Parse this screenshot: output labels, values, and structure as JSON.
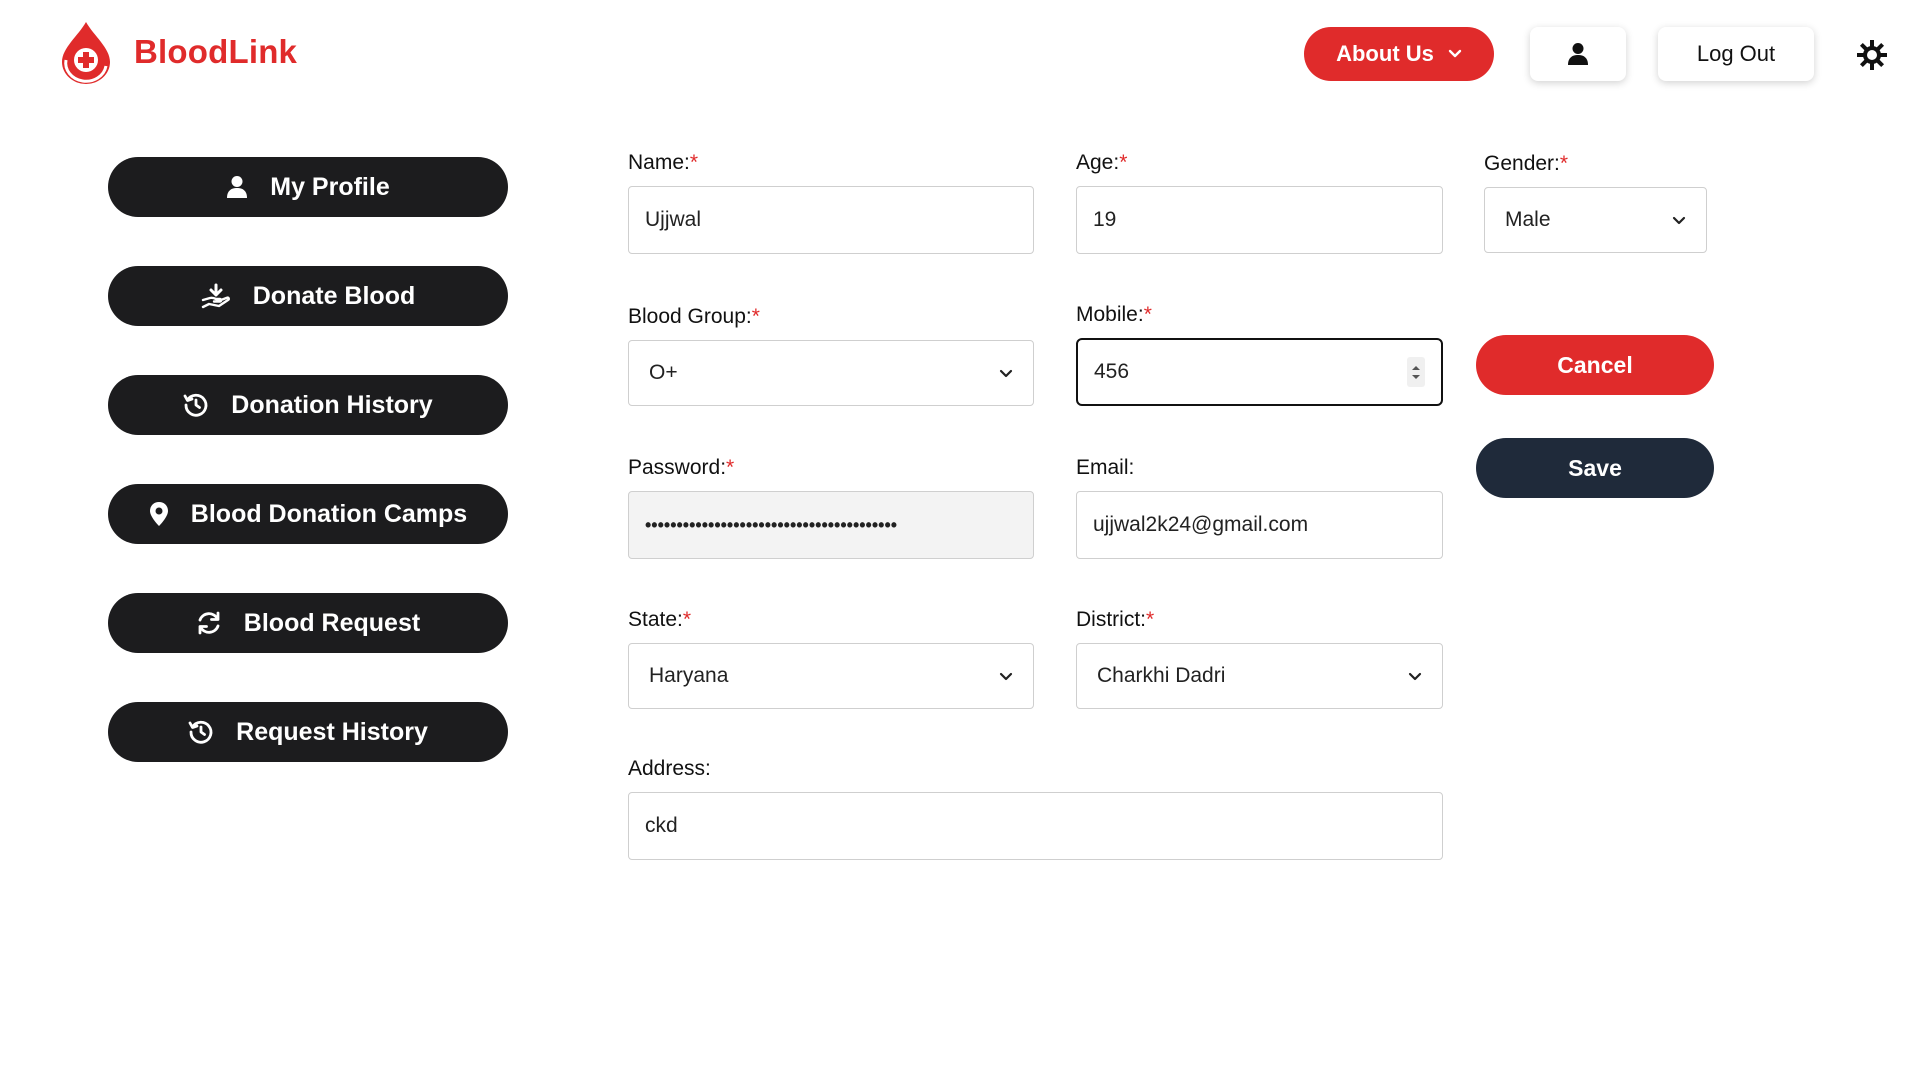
{
  "header": {
    "brand": "BloodLink",
    "about_label": "About Us",
    "logout_label": "Log Out",
    "brand_color": "#e02b2b"
  },
  "sidebar": {
    "items": [
      {
        "label": "My Profile",
        "icon": "user-icon"
      },
      {
        "label": "Donate Blood",
        "icon": "donate-hand-icon"
      },
      {
        "label": "Donation History",
        "icon": "history-icon"
      },
      {
        "label": "Blood Donation Camps",
        "icon": "location-pin-icon"
      },
      {
        "label": "Blood Request",
        "icon": "refresh-icon"
      },
      {
        "label": "Request History",
        "icon": "history-icon"
      }
    ]
  },
  "form": {
    "name": {
      "label": "Name:",
      "value": "Ujjwal"
    },
    "age": {
      "label": "Age:",
      "value": "19"
    },
    "gender": {
      "label": "Gender:",
      "value": "Male"
    },
    "blood_group": {
      "label": "Blood Group:",
      "value": "O+"
    },
    "mobile": {
      "label": "Mobile:",
      "value": "456"
    },
    "password": {
      "label": "Password:",
      "value": "••••••••••••••••••••••••••••••••••••••••"
    },
    "email": {
      "label": "Email:",
      "value": "ujjwal2k24@gmail.com"
    },
    "state": {
      "label": "State:",
      "value": "Haryana"
    },
    "district": {
      "label": "District:",
      "value": "Charkhi Dadri"
    },
    "address": {
      "label": "Address:",
      "value": "ckd"
    },
    "required_mark": "*"
  },
  "actions": {
    "cancel_label": "Cancel",
    "save_label": "Save"
  }
}
